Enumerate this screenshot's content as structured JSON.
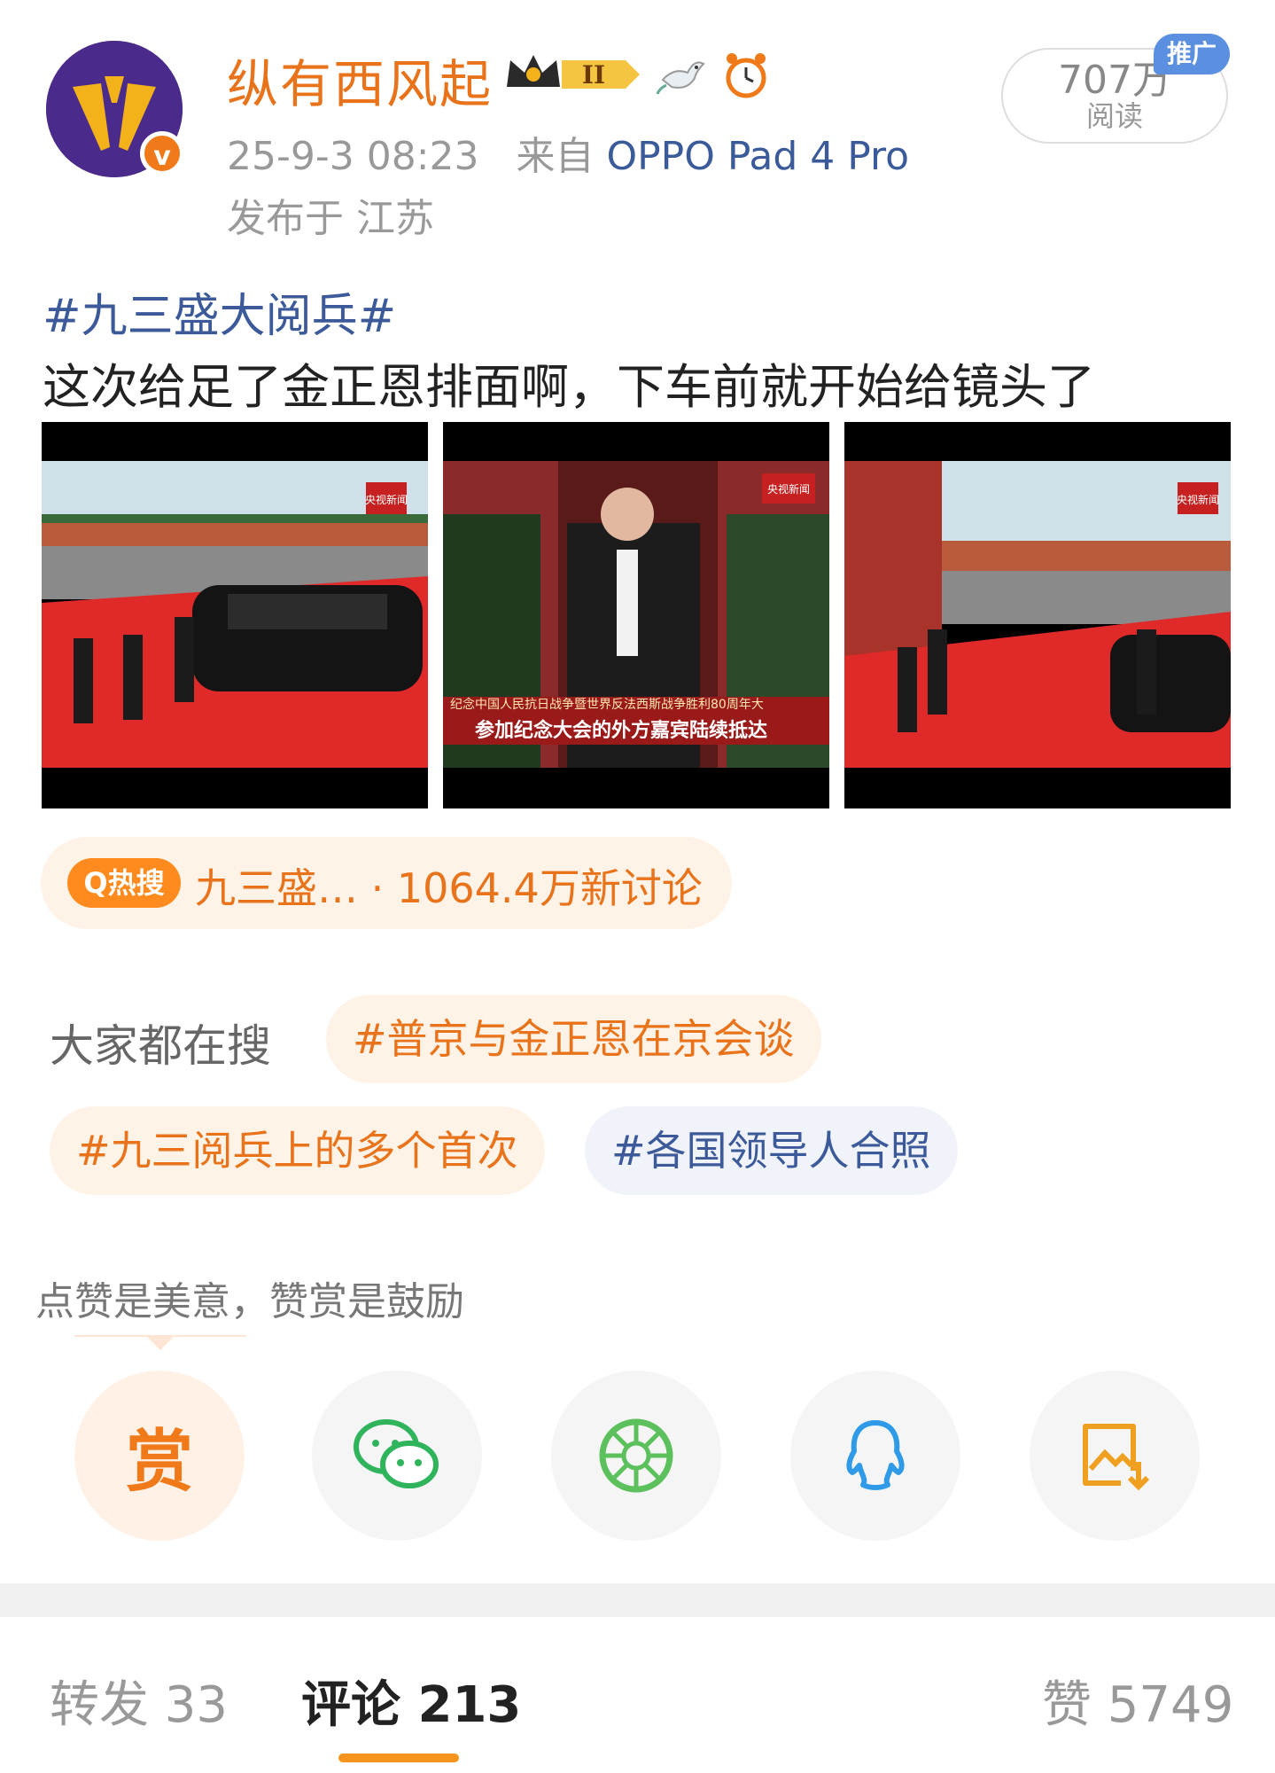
{
  "post": {
    "username": "纵有西风起",
    "time": "25-9-3 08:23",
    "source_prefix": "来自",
    "device": "OPPO Pad 4 Pro",
    "location": "发布于 江苏",
    "reads_count": "707万",
    "reads_label": "阅读",
    "promo_label": "推广",
    "topic": "#九三盛大阅兵#",
    "text": "这次给足了金正恩排面啊，下车前就开始给镜头了"
  },
  "images": {
    "img2_caption_small": "纪念中国人民抗日战争暨世界反法西斯战争胜利80周年大",
    "img2_caption_main": "参加纪念大会的外方嘉宾陆续抵达",
    "channel_tag": "央视新闻"
  },
  "hot": {
    "icon_label": "Q热搜",
    "text": "九三盛… · 1064.4万新讨论"
  },
  "search": {
    "label": "大家都在搜",
    "chips": [
      "#普京与金正恩在京会谈",
      "#九三阅兵上的多个首次",
      "#各国领导人合照"
    ]
  },
  "reward": {
    "tip": "点赞是美意，赞赏是鼓励",
    "reward_label": "赏"
  },
  "share_icons": [
    "reward-icon",
    "wechat-icon",
    "moments-icon",
    "qq-icon",
    "save-image-icon"
  ],
  "stats": {
    "repost": "转发 33",
    "comment": "评论 213",
    "like": "赞 5749"
  },
  "colors": {
    "accent": "#f7941d",
    "username": "#e8731a",
    "topic": "#3c5a9a",
    "wechat": "#2fb45c",
    "qq": "#2f9be8"
  }
}
